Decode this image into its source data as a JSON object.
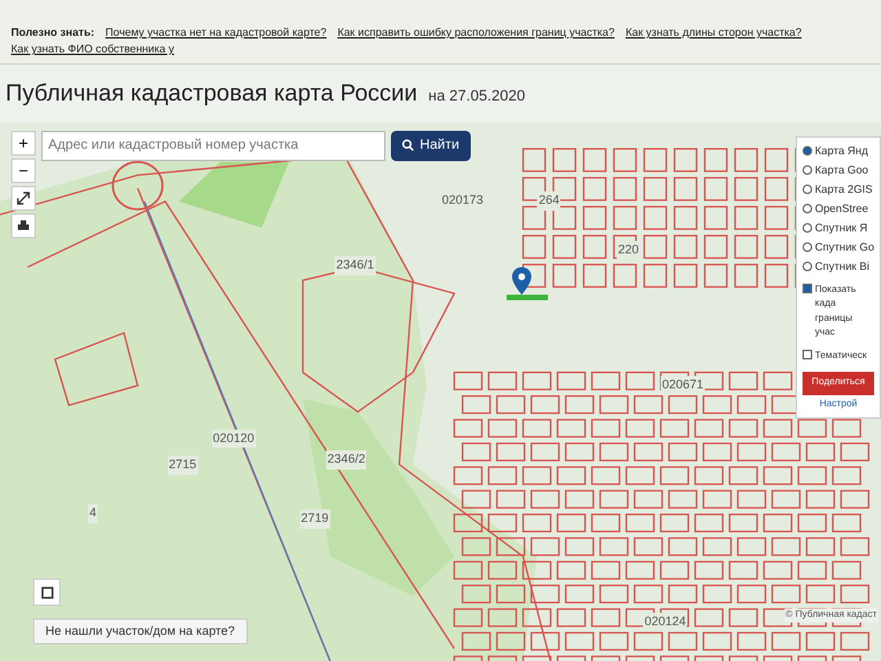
{
  "info_bar": {
    "label": "Полезно знать:",
    "links": [
      "Почему участка нет на кадастровой карте?",
      "Как исправить ошибку расположения границ участка?",
      "Как узнать длины сторон участка?",
      "Как узнать ФИО собственника у"
    ]
  },
  "header": {
    "title": "Публичная кадастровая карта России",
    "date": "на 27.05.2020"
  },
  "search": {
    "placeholder": "Адрес или кадастровый номер участка",
    "button": "Найти"
  },
  "zoom": {
    "in": "+",
    "out": "−"
  },
  "map_labels": [
    "020173",
    "2346/1",
    "020120",
    "4",
    "2715",
    "2346/2",
    "2719",
    "020671",
    "020124",
    "264",
    "220"
  ],
  "layers": [
    {
      "label": "Карта Янд",
      "selected": true
    },
    {
      "label": "Карта Goo",
      "selected": false
    },
    {
      "label": "Карта 2GIS",
      "selected": false
    },
    {
      "label": "OpenStree",
      "selected": false
    },
    {
      "label": "Спутник Я",
      "selected": false
    },
    {
      "label": "Спутник Go",
      "selected": false
    },
    {
      "label": "Спутник Bi",
      "selected": false
    }
  ],
  "options": [
    {
      "label": "Показать када границы учас",
      "checked": true
    },
    {
      "label": "Тематическ",
      "checked": false
    }
  ],
  "share_button": "Поделиться",
  "settings_link": "Настрой",
  "not_found_button": "Не нашли участок/дом на карте?",
  "attribution": "© Публичная кадаст"
}
